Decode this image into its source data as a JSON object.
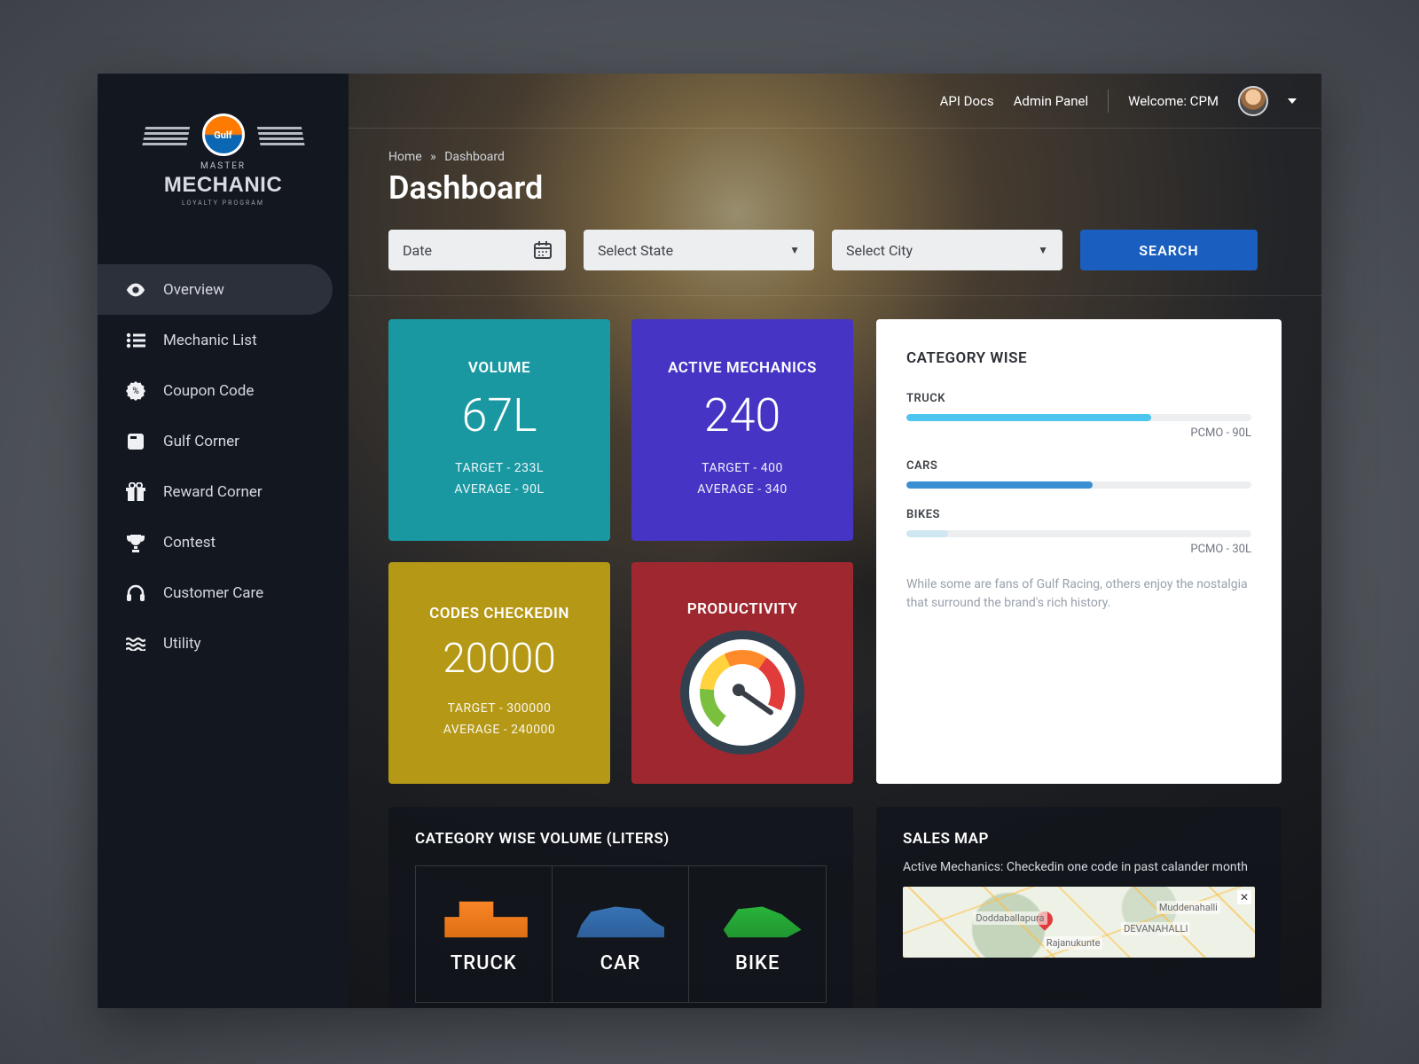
{
  "brand": {
    "gulf": "Gulf",
    "master": "MASTER",
    "mechanic": "MECHANIC",
    "loyalty": "LOYALTY PROGRAM"
  },
  "nav": [
    {
      "label": "Overview",
      "icon": "eye"
    },
    {
      "label": "Mechanic List",
      "icon": "list"
    },
    {
      "label": "Coupon Code",
      "icon": "badge"
    },
    {
      "label": "Gulf Corner",
      "icon": "book"
    },
    {
      "label": "Reward Corner",
      "icon": "gift"
    },
    {
      "label": "Contest",
      "icon": "trophy"
    },
    {
      "label": "Customer Care",
      "icon": "headset"
    },
    {
      "label": "Utility",
      "icon": "waves"
    }
  ],
  "topbar": {
    "api": "API Docs",
    "admin": "Admin Panel",
    "welcome": "Welcome: CPM"
  },
  "breadcrumb": {
    "home": "Home",
    "sep": "»",
    "current": "Dashboard"
  },
  "page_title": "Dashboard",
  "filters": {
    "date": "Date",
    "state": "Select State",
    "city": "Select City",
    "search": "SEARCH"
  },
  "tiles": {
    "volume": {
      "title": "VOLUME",
      "value": "67L",
      "target": "TARGET - 233L",
      "average": "AVERAGE - 90L"
    },
    "active": {
      "title": "ACTIVE MECHANICS",
      "value": "240",
      "target": "TARGET - 400",
      "average": "AVERAGE - 340"
    },
    "codes": {
      "title": "CODES CHECKEDIN",
      "value": "20000",
      "target": "TARGET - 300000",
      "average": "AVERAGE - 240000"
    },
    "prod": {
      "title": "PRODUCTIVITY"
    }
  },
  "category_wise": {
    "title": "CATEGORY WISE",
    "rows": [
      {
        "label": "TRUCK",
        "pct": 71,
        "color": "#4cc6ef",
        "value": "PCMO - 90L"
      },
      {
        "label": "CARS",
        "pct": 54,
        "color": "#3b8fd3",
        "value": ""
      },
      {
        "label": "BIKES",
        "pct": 12,
        "color": "#cfe7f2",
        "value": "PCMO - 30L"
      }
    ],
    "note": "While some are fans of Gulf Racing, others enjoy the nostalgia that surround the brand's rich history."
  },
  "cat_volume": {
    "title": "CATEGORY WISE VOLUME (LITERS)",
    "items": [
      "TRUCK",
      "CAR",
      "BIKE"
    ]
  },
  "sales_map": {
    "title": "SALES MAP",
    "subtitle": "Active Mechanics: Checkedin one code in past calander month",
    "labels": [
      "Doddaballapura",
      "Muddenahalli",
      "Rajanukunte",
      "DEVANAHALLI"
    ]
  },
  "colors": {
    "teal": "#1a98a2",
    "indigo": "#4635c4",
    "olive": "#b59815",
    "maroon": "#9f2830",
    "primary": "#1a5fbf"
  }
}
